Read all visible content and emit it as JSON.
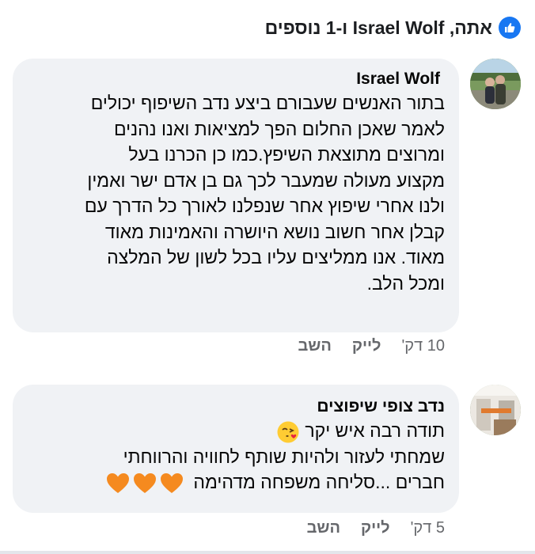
{
  "reactions": {
    "summary": "אתה, Israel Wolf ו-1 נוספים",
    "icon": "like-thumb-icon",
    "color": "#1877f2"
  },
  "comments": [
    {
      "author": "Israel Wolf",
      "lines": [
        "בתור  האנשים שעבורם ביצע נדב השיפוף יכולים",
        "לאמר שאכן החלום הפך למציאות ואנו נהנים",
        "ומרוצים מתוצאת השיפץ.כמו כן הכרנו בעל",
        "מקצוע מעולה שמעבר לכך גם בן אדם ישר ואמין",
        "ולנו אחרי שיפוץ אחר שנפלנו לאורך כל הדרך עם",
        "קבלן אחר חשוב נושא היושרה והאמינות מאוד",
        "מאוד. אנו ממליצים עליו בכל לשון של המלצה",
        "ומכל הלב."
      ],
      "time": "10 דק'",
      "like_label": "לייק",
      "reply_label": "השב"
    },
    {
      "author": "נדב צופי שיפוצים",
      "line1": "תודה רבה איש יקר",
      "line2": "שמחתי לעזור ולהיות שותף לחוויה והרווחתי",
      "line3": "חברים ...סליחה משפחה מדהימה",
      "emoji1": "face-blowing-kiss-icon",
      "emoji2": "orange-heart-icon",
      "time": "5 דק'",
      "like_label": "לייק",
      "reply_label": "השב"
    }
  ],
  "colors": {
    "bubble": "#f0f2f5",
    "meta": "#65676b",
    "heart": "#f58a1f"
  }
}
